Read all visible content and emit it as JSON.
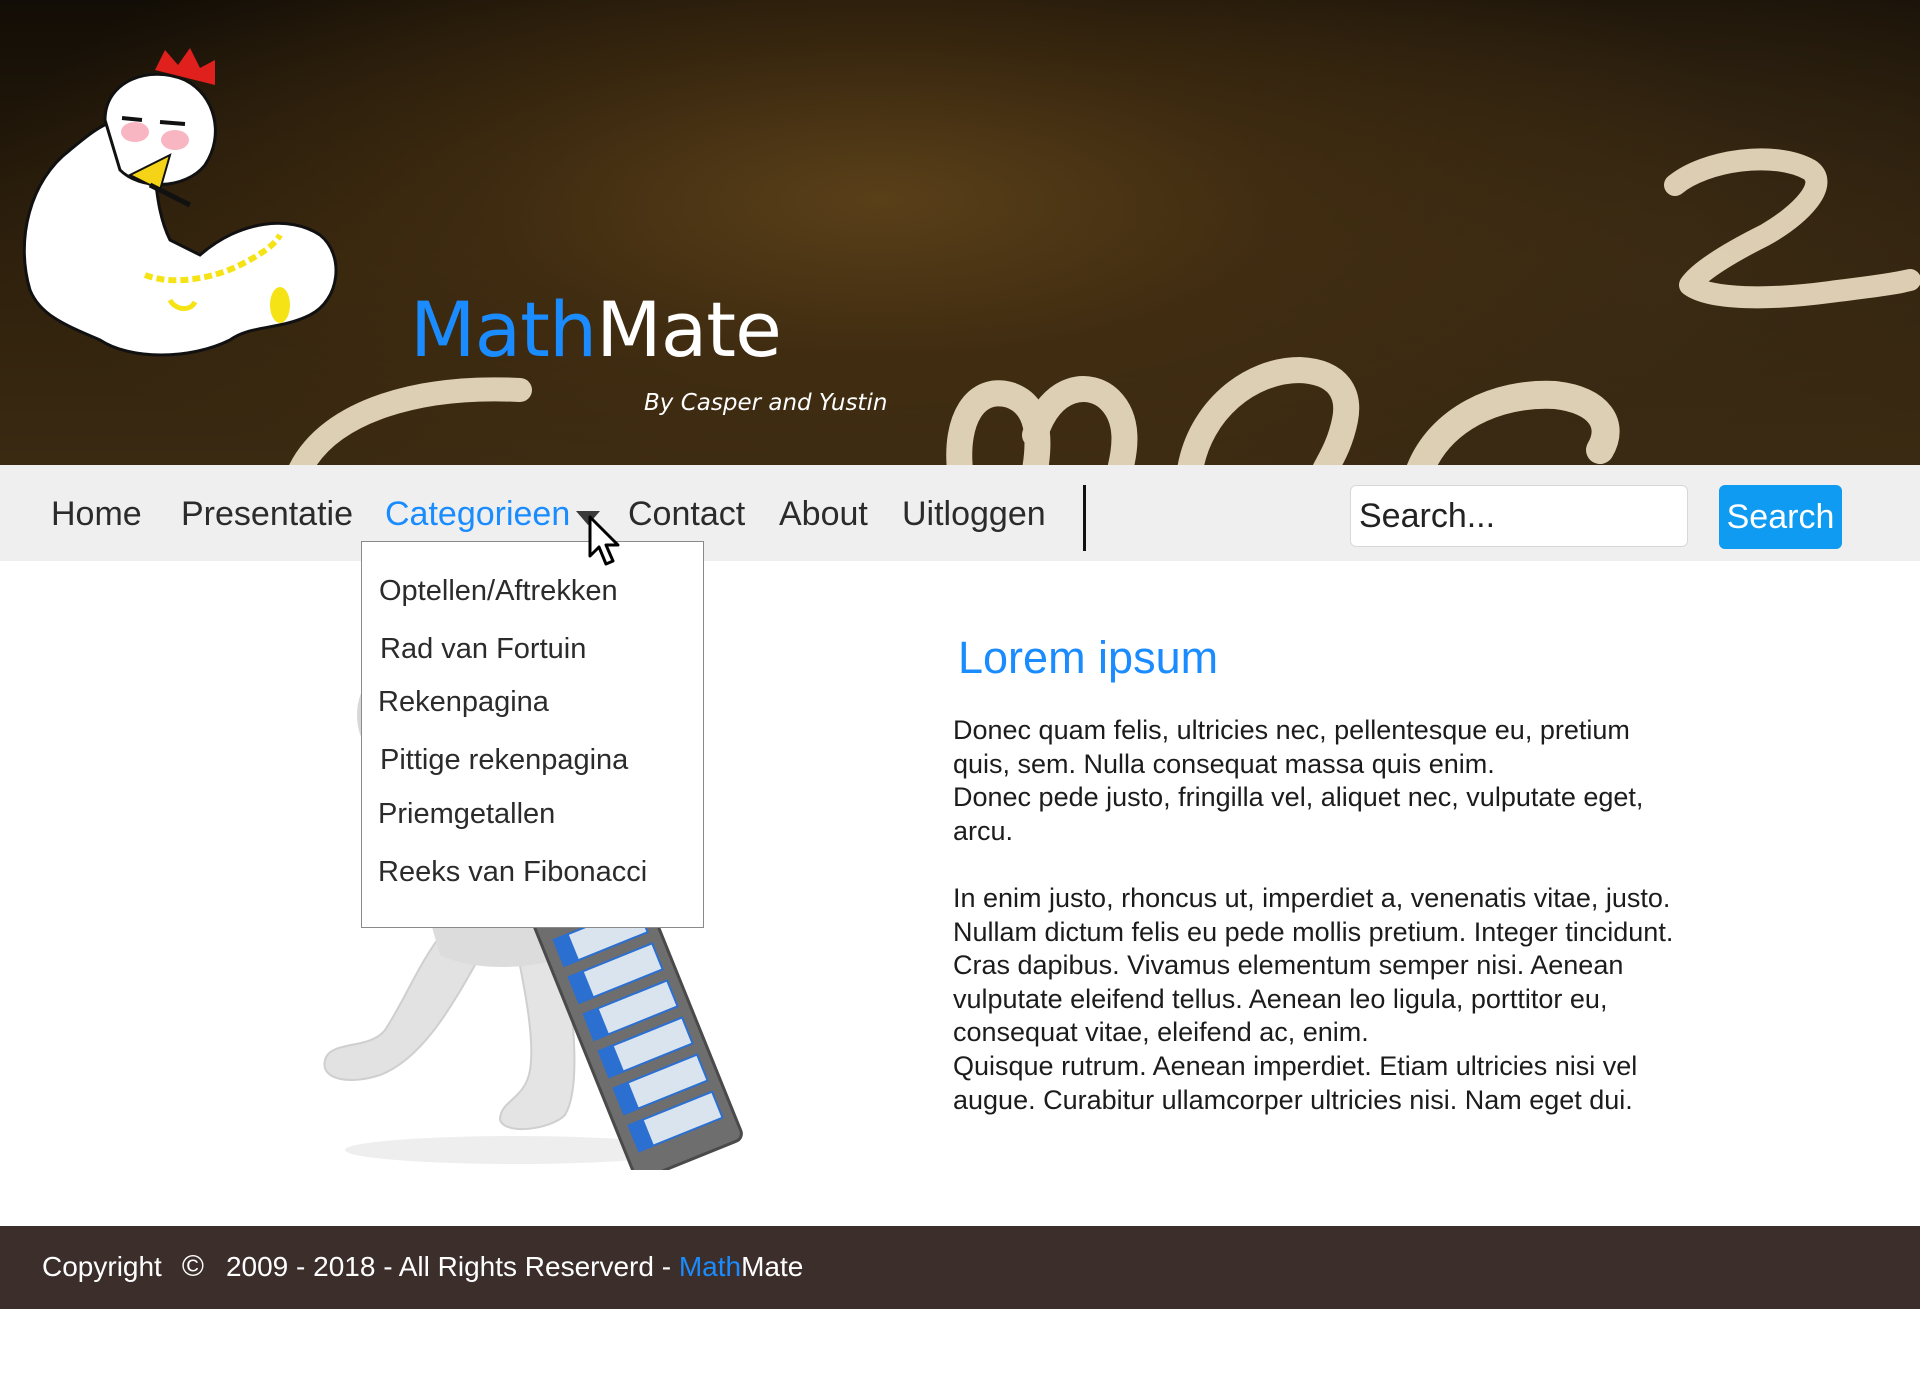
{
  "header": {
    "brand_math": "Math",
    "brand_mate": "Mate",
    "byline": "By Casper and Yustin"
  },
  "nav": {
    "items": [
      {
        "label": "Home"
      },
      {
        "label": "Presentatie"
      },
      {
        "label": "Categorieen",
        "active": true
      },
      {
        "label": "Contact"
      },
      {
        "label": "About"
      },
      {
        "label": "Uitloggen"
      }
    ],
    "search_placeholder": "Search...",
    "search_button": "Search"
  },
  "dropdown": {
    "items": [
      {
        "label": "Optellen/Aftrekken"
      },
      {
        "label": "Rad van Fortuin"
      },
      {
        "label": "Rekenpagina"
      },
      {
        "label": "Pittige rekenpagina"
      },
      {
        "label": "Priemgetallen"
      },
      {
        "label": "Reeks van Fibonacci"
      }
    ]
  },
  "main": {
    "heading": "Lorem ipsum",
    "body": "Donec quam felis, ultricies nec, pellentesque eu, pretium\nquis, sem. Nulla consequat massa quis enim.\n Donec pede justo, fringilla vel, aliquet nec, vulputate eget,\narcu.\n\nIn enim justo, rhoncus ut, imperdiet a, venenatis vitae, justo.\nNullam dictum felis eu pede mollis pretium. Integer tincidunt.\nCras dapibus. Vivamus elementum semper nisi. Aenean\nvulputate eleifend tellus. Aenean leo ligula, porttitor eu,\nconsequat vitae, eleifend ac, enim.\nQuisque rutrum. Aenean imperdiet. Etiam ultricies nisi vel\naugue. Curabitur ullamcorper ultricies nisi. Nam eget dui."
  },
  "footer": {
    "copyright_label": "Copyright",
    "copyright_symbol": "©",
    "years": "2009 - 2018 - All Rights Reserverd - ",
    "brand_math": "Math",
    "brand_mate": "Mate"
  },
  "colors": {
    "accent": "#1a8cff",
    "search_button": "#0f9bf2",
    "navbar_bg": "#efefef",
    "footer_bg": "#3b2e2b",
    "text": "#2b2b2b"
  },
  "icons": {
    "dropdown_caret": "caret-down-icon",
    "mouse_cursor": "mouse-pointer-icon",
    "copyright": "copyright-icon"
  }
}
